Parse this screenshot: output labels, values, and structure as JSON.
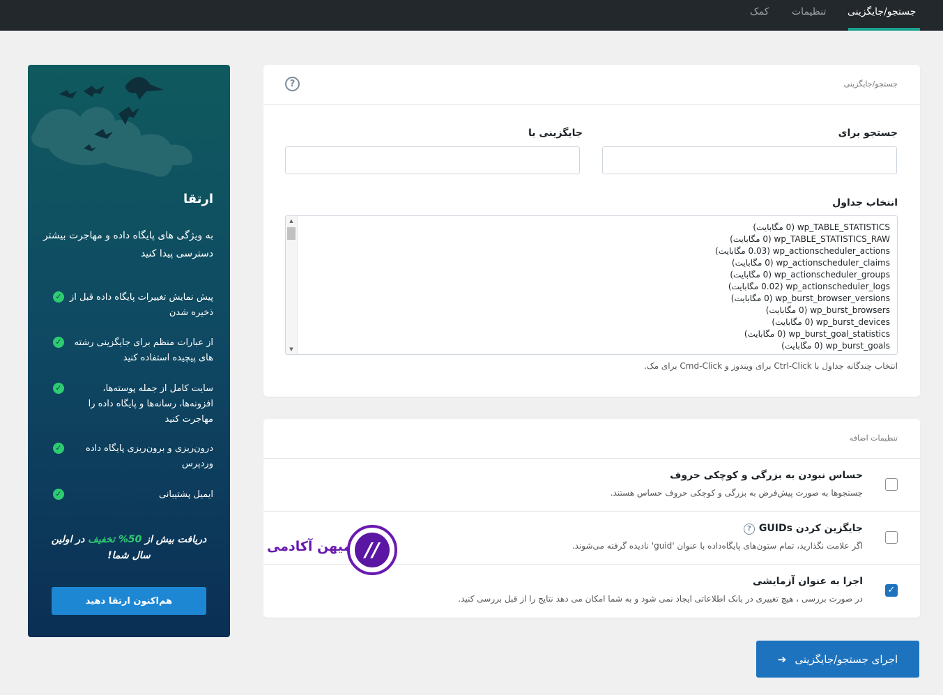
{
  "tabs": [
    {
      "label": "جستجو/جایگزینی",
      "active": true
    },
    {
      "label": "تنظیمات",
      "active": false
    },
    {
      "label": "کمک",
      "active": false
    }
  ],
  "search_card": {
    "title": "جستجو/جایگزینی",
    "search_label": "جستجو برای",
    "replace_label": "جایگزینی با",
    "search_value": "",
    "replace_value": "",
    "tables_label": "انتخاب جداول",
    "tables": [
      "wp_TABLE_STATISTICS (0 مگابایت)",
      "wp_TABLE_STATISTICS_RAW (0 مگابایت)",
      "wp_actionscheduler_actions (0.03 مگابایت)",
      "wp_actionscheduler_claims (0 مگابایت)",
      "wp_actionscheduler_groups (0 مگابایت)",
      "wp_actionscheduler_logs (0.02 مگابایت)",
      "wp_burst_browser_versions (0 مگابایت)",
      "wp_burst_browsers (0 مگابایت)",
      "wp_burst_devices (0 مگابایت)",
      "wp_burst_goal_statistics (0 مگابایت)",
      "wp_burst_goals (0 مگابایت)"
    ],
    "tables_hint": "انتخاب چندگانه جداول با Ctrl-Click برای ویندوز و Cmd-Click برای مک."
  },
  "options_card": {
    "title": "تنظیمات اضافه",
    "options": [
      {
        "title": "حساس نبودن به بزرگی و کوچکی حروف",
        "desc": "جستجوها به صورت پیش‌فرض به بزرگی و کوچکی حروف حساس هستند.",
        "checked": false
      },
      {
        "title": "جایگزین کردن GUIDs",
        "desc": "اگر علامت نگذارید، تمام ستون‌های پایگاه‌داده با عنوان 'guid' نادیده گرفته می‌شوند.",
        "checked": false
      },
      {
        "title": "اجرا به عنوان آزمایشی",
        "desc": "در صورت بررسی ، هیچ تغییری در بانک اطلاعاتی ایجاد نمی شود و به شما امکان می دهد نتایج را از قبل بررسی کنید.",
        "checked": true
      }
    ]
  },
  "run_button": "اجرای جستجو/جایگزینی",
  "watermark": "میهن آکادمی",
  "sidebar": {
    "title": "ارتقا",
    "subtitle": "به ویژگی های پایگاه داده و مهاجرت بیشتر دسترسی پیدا کنید",
    "features": [
      "پیش نمایش تغییرات پایگاه داده قبل از ذخیره شدن",
      "از عبارات منظم برای جایگزینی رشته های پیچیده استفاده کنید",
      "سایت کامل از جمله پوسته‌ها، افزونه‌ها، رسانه‌ها و پایگاه داده را مهاجرت کنید",
      "درون‌ریزی و برون‌ریزی پایگاه داده وردپرس",
      "ایمیل پشتیبانی"
    ],
    "promo_prefix": "دریافت بیش از ",
    "promo_accent": "50% تخفیف",
    "promo_suffix": " در اولین سال شما!",
    "upgrade_button": "هم‌اکنون ارتقا دهید"
  },
  "colors": {
    "accent": "#1aa28c",
    "primary_button": "#1e73be",
    "check_green": "#2ecc71"
  }
}
